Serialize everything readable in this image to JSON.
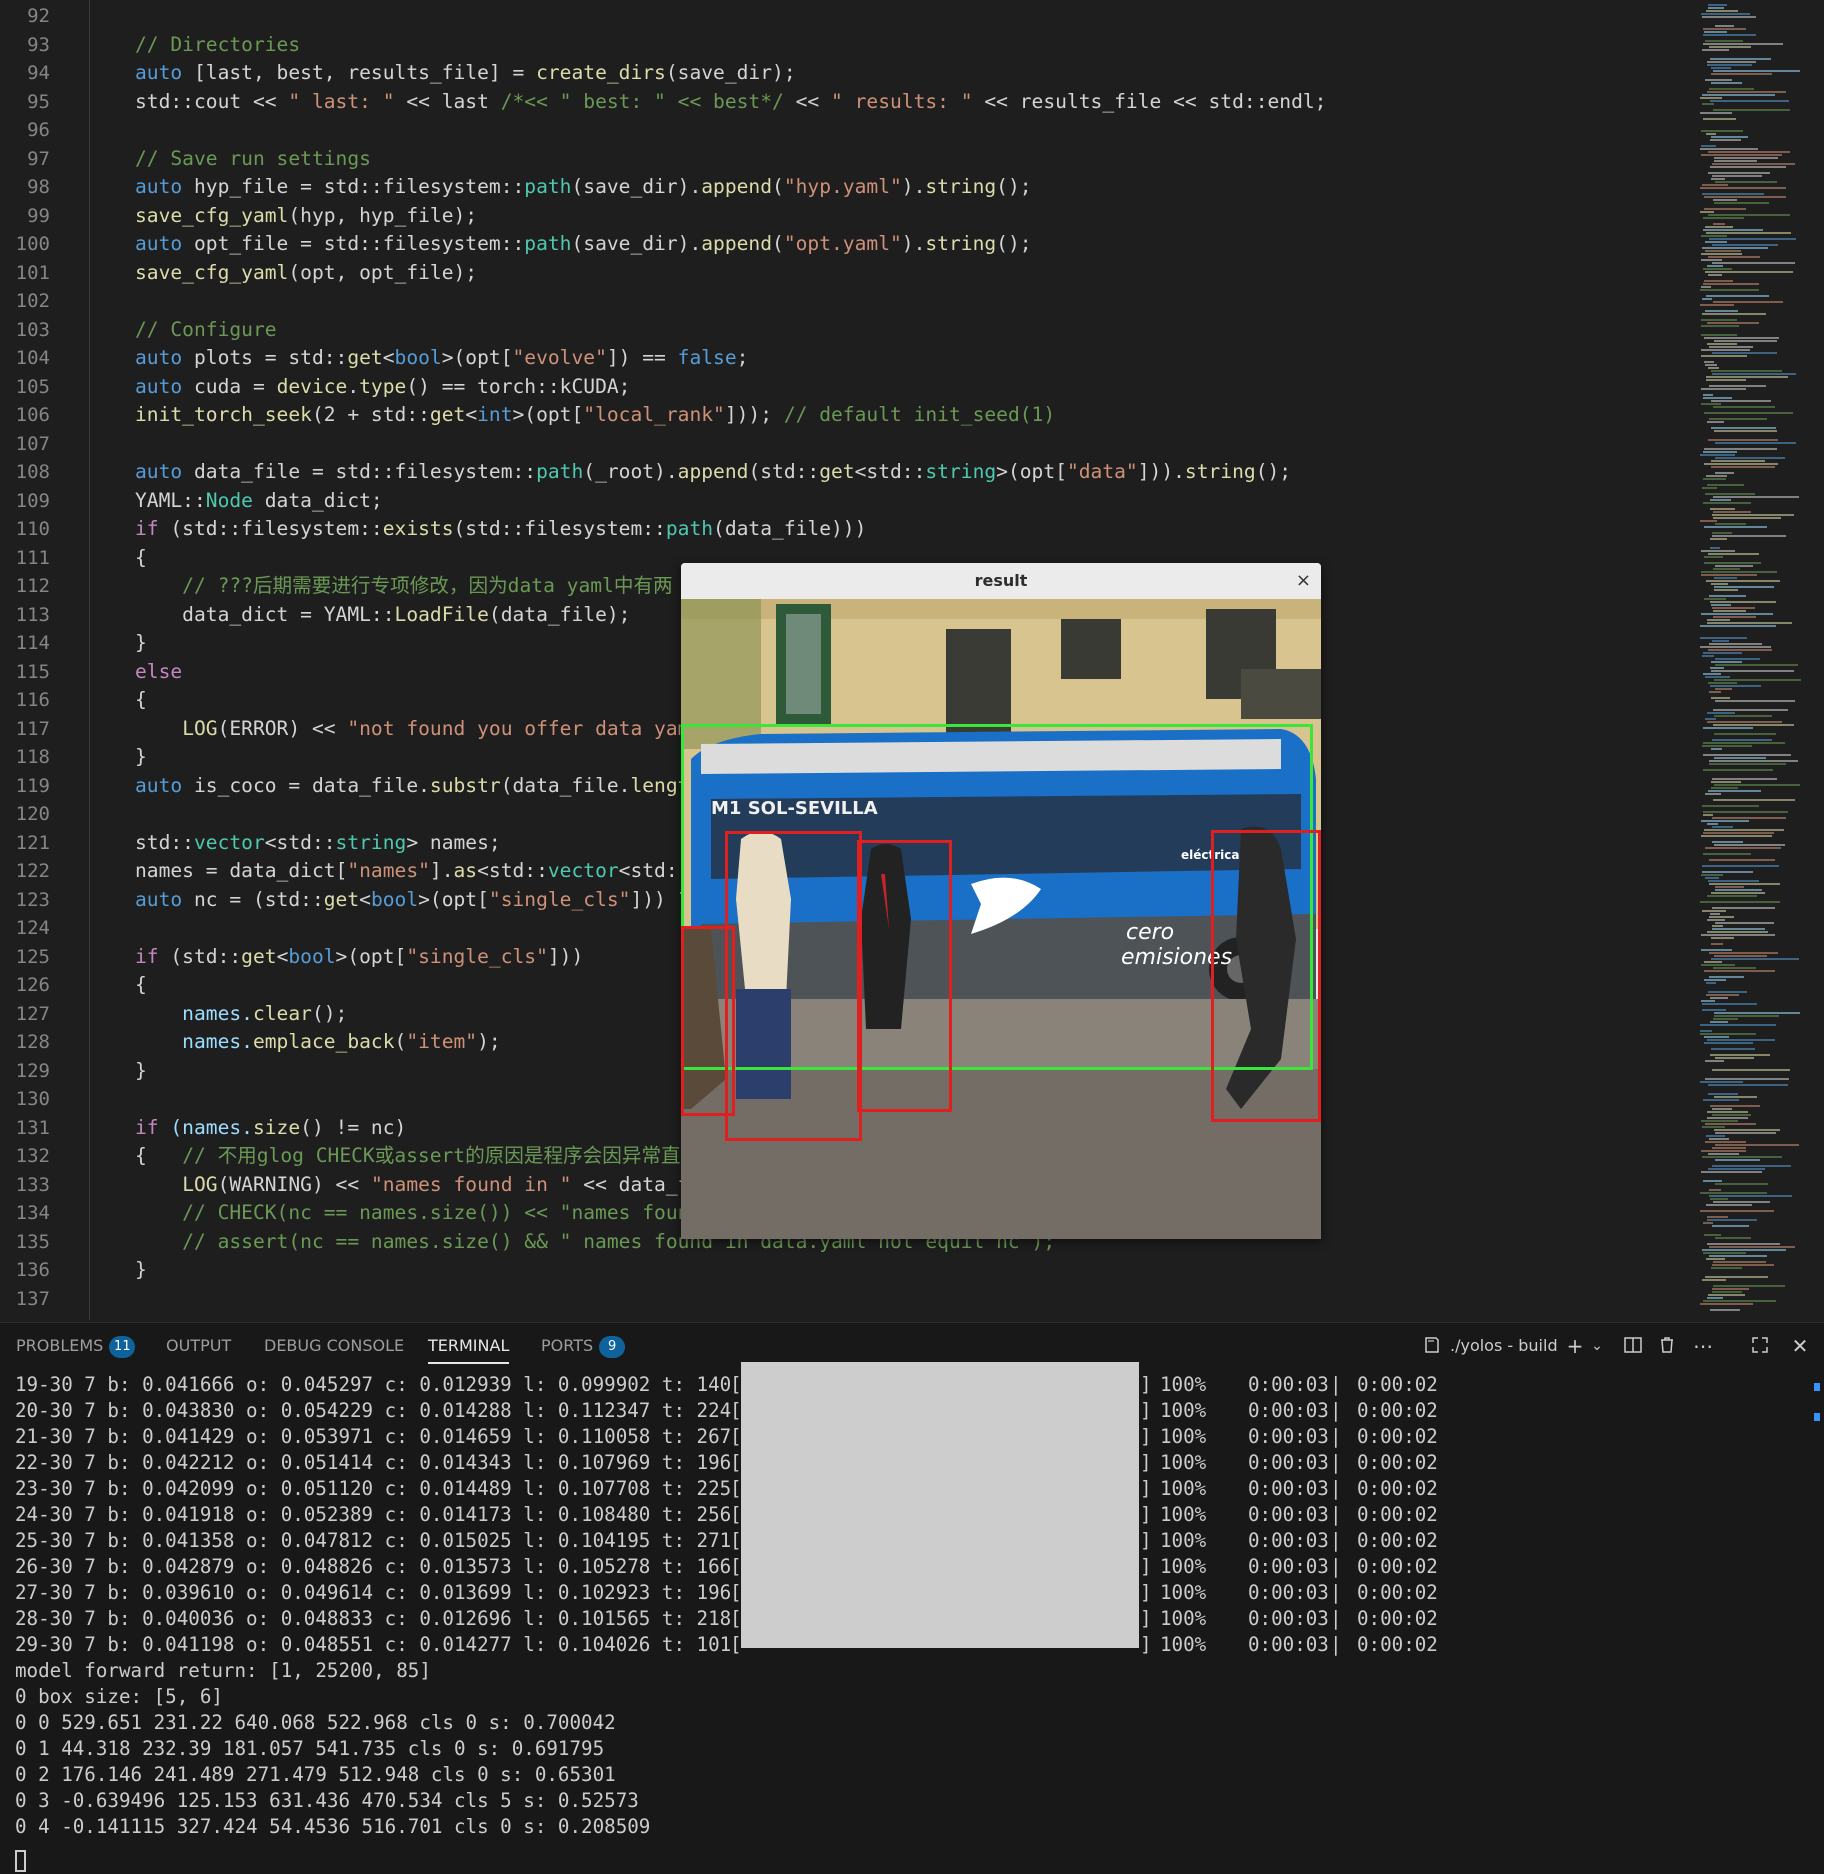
{
  "editor": {
    "lines": [
      {
        "n": "92",
        "segs": []
      },
      {
        "n": "93",
        "segs": [
          {
            "t": "// Directories",
            "c": "#6a9955"
          }
        ]
      },
      {
        "n": "94",
        "segs": [
          {
            "t": "auto ",
            "c": "#569cd6"
          },
          {
            "t": "[last, best, results_file] = ",
            "c": "#d4d4d4"
          },
          {
            "t": "create_dirs",
            "c": "#dcdcaa"
          },
          {
            "t": "(save_dir);",
            "c": "#d4d4d4"
          }
        ]
      },
      {
        "n": "95",
        "segs": [
          {
            "t": "std::cout << ",
            "c": "#d4d4d4"
          },
          {
            "t": "\" last: \"",
            "c": "#ce9178"
          },
          {
            "t": " << last ",
            "c": "#d4d4d4"
          },
          {
            "t": "/*<< \" best: \" << best*/",
            "c": "#6a9955"
          },
          {
            "t": " << ",
            "c": "#d4d4d4"
          },
          {
            "t": "\" results: \"",
            "c": "#ce9178"
          },
          {
            "t": " << results_file << std::endl;",
            "c": "#d4d4d4"
          }
        ]
      },
      {
        "n": "96",
        "segs": []
      },
      {
        "n": "97",
        "segs": [
          {
            "t": "// Save run settings",
            "c": "#6a9955"
          }
        ]
      },
      {
        "n": "98",
        "segs": [
          {
            "t": "auto ",
            "c": "#569cd6"
          },
          {
            "t": "hyp_file = std::filesystem::",
            "c": "#d4d4d4"
          },
          {
            "t": "path",
            "c": "#4ec9b0"
          },
          {
            "t": "(save_dir).",
            "c": "#d4d4d4"
          },
          {
            "t": "append",
            "c": "#dcdcaa"
          },
          {
            "t": "(",
            "c": "#d4d4d4"
          },
          {
            "t": "\"hyp.yaml\"",
            "c": "#ce9178"
          },
          {
            "t": ").",
            "c": "#d4d4d4"
          },
          {
            "t": "string",
            "c": "#dcdcaa"
          },
          {
            "t": "();",
            "c": "#d4d4d4"
          }
        ]
      },
      {
        "n": "99",
        "segs": [
          {
            "t": "save_cfg_yaml",
            "c": "#dcdcaa"
          },
          {
            "t": "(hyp, hyp_file);",
            "c": "#d4d4d4"
          }
        ]
      },
      {
        "n": "100",
        "segs": [
          {
            "t": "auto ",
            "c": "#569cd6"
          },
          {
            "t": "opt_file = std::filesystem::",
            "c": "#d4d4d4"
          },
          {
            "t": "path",
            "c": "#4ec9b0"
          },
          {
            "t": "(save_dir).",
            "c": "#d4d4d4"
          },
          {
            "t": "append",
            "c": "#dcdcaa"
          },
          {
            "t": "(",
            "c": "#d4d4d4"
          },
          {
            "t": "\"opt.yaml\"",
            "c": "#ce9178"
          },
          {
            "t": ").",
            "c": "#d4d4d4"
          },
          {
            "t": "string",
            "c": "#dcdcaa"
          },
          {
            "t": "();",
            "c": "#d4d4d4"
          }
        ]
      },
      {
        "n": "101",
        "segs": [
          {
            "t": "save_cfg_yaml",
            "c": "#dcdcaa"
          },
          {
            "t": "(opt, opt_file);",
            "c": "#d4d4d4"
          }
        ]
      },
      {
        "n": "102",
        "segs": []
      },
      {
        "n": "103",
        "segs": [
          {
            "t": "// Configure",
            "c": "#6a9955"
          }
        ]
      },
      {
        "n": "104",
        "segs": [
          {
            "t": "auto ",
            "c": "#569cd6"
          },
          {
            "t": "plots = std::",
            "c": "#d4d4d4"
          },
          {
            "t": "get",
            "c": "#dcdcaa"
          },
          {
            "t": "<",
            "c": "#d4d4d4"
          },
          {
            "t": "bool",
            "c": "#569cd6"
          },
          {
            "t": ">(opt[",
            "c": "#d4d4d4"
          },
          {
            "t": "\"evolve\"",
            "c": "#ce9178"
          },
          {
            "t": "]) == ",
            "c": "#d4d4d4"
          },
          {
            "t": "false",
            "c": "#569cd6"
          },
          {
            "t": ";",
            "c": "#d4d4d4"
          }
        ]
      },
      {
        "n": "105",
        "segs": [
          {
            "t": "auto ",
            "c": "#569cd6"
          },
          {
            "t": "cuda = ",
            "c": "#d4d4d4"
          },
          {
            "t": "device",
            "c": "#dcdcaa"
          },
          {
            "t": ".",
            "c": "#d4d4d4"
          },
          {
            "t": "type",
            "c": "#dcdcaa"
          },
          {
            "t": "() == torch::kCUDA;",
            "c": "#d4d4d4"
          }
        ]
      },
      {
        "n": "106",
        "segs": [
          {
            "t": "init_torch_seek",
            "c": "#dcdcaa"
          },
          {
            "t": "(2 + std::",
            "c": "#d4d4d4"
          },
          {
            "t": "get",
            "c": "#dcdcaa"
          },
          {
            "t": "<",
            "c": "#d4d4d4"
          },
          {
            "t": "int",
            "c": "#569cd6"
          },
          {
            "t": ">(opt[",
            "c": "#d4d4d4"
          },
          {
            "t": "\"local_rank\"",
            "c": "#ce9178"
          },
          {
            "t": "])); ",
            "c": "#d4d4d4"
          },
          {
            "t": "// default init_seed(1)",
            "c": "#6a9955"
          }
        ]
      },
      {
        "n": "107",
        "segs": []
      },
      {
        "n": "108",
        "segs": [
          {
            "t": "auto ",
            "c": "#569cd6"
          },
          {
            "t": "data_file = std::filesystem::",
            "c": "#d4d4d4"
          },
          {
            "t": "path",
            "c": "#4ec9b0"
          },
          {
            "t": "(_root).",
            "c": "#d4d4d4"
          },
          {
            "t": "append",
            "c": "#dcdcaa"
          },
          {
            "t": "(std::",
            "c": "#d4d4d4"
          },
          {
            "t": "get",
            "c": "#dcdcaa"
          },
          {
            "t": "<std::",
            "c": "#d4d4d4"
          },
          {
            "t": "string",
            "c": "#4ec9b0"
          },
          {
            "t": ">(opt[",
            "c": "#d4d4d4"
          },
          {
            "t": "\"data\"",
            "c": "#ce9178"
          },
          {
            "t": "])).",
            "c": "#d4d4d4"
          },
          {
            "t": "string",
            "c": "#dcdcaa"
          },
          {
            "t": "();",
            "c": "#d4d4d4"
          }
        ]
      },
      {
        "n": "109",
        "segs": [
          {
            "t": "YAML::",
            "c": "#d4d4d4"
          },
          {
            "t": "Node",
            "c": "#4ec9b0"
          },
          {
            "t": " data_dict;",
            "c": "#d4d4d4"
          }
        ]
      },
      {
        "n": "110",
        "segs": [
          {
            "t": "if ",
            "c": "#c586c0"
          },
          {
            "t": "(std::filesystem::",
            "c": "#d4d4d4"
          },
          {
            "t": "exists",
            "c": "#dcdcaa"
          },
          {
            "t": "(std::filesystem::",
            "c": "#d4d4d4"
          },
          {
            "t": "path",
            "c": "#4ec9b0"
          },
          {
            "t": "(data_file)))",
            "c": "#d4d4d4"
          }
        ]
      },
      {
        "n": "111",
        "segs": [
          {
            "t": "{",
            "c": "#d4d4d4"
          }
        ]
      },
      {
        "n": "112",
        "segs": [
          {
            "t": "    // ???后期需要进行专项修改，因为data yaml中有两",
            "c": "#6a9955"
          }
        ]
      },
      {
        "n": "113",
        "segs": [
          {
            "t": "    data_dict = YAML::",
            "c": "#d4d4d4"
          },
          {
            "t": "LoadFile",
            "c": "#dcdcaa"
          },
          {
            "t": "(data_file);",
            "c": "#d4d4d4"
          }
        ]
      },
      {
        "n": "114",
        "segs": [
          {
            "t": "}",
            "c": "#d4d4d4"
          }
        ]
      },
      {
        "n": "115",
        "segs": [
          {
            "t": "else",
            "c": "#c586c0"
          }
        ]
      },
      {
        "n": "116",
        "segs": [
          {
            "t": "{",
            "c": "#d4d4d4"
          }
        ]
      },
      {
        "n": "117",
        "segs": [
          {
            "t": "    ",
            "c": "#d4d4d4"
          },
          {
            "t": "LOG",
            "c": "#dcdcaa"
          },
          {
            "t": "(ERROR) << ",
            "c": "#d4d4d4"
          },
          {
            "t": "\"not found you offer data yaml",
            "c": "#ce9178"
          }
        ]
      },
      {
        "n": "118",
        "segs": [
          {
            "t": "}",
            "c": "#d4d4d4"
          }
        ]
      },
      {
        "n": "119",
        "segs": [
          {
            "t": "auto ",
            "c": "#569cd6"
          },
          {
            "t": "is_coco = data_file.",
            "c": "#d4d4d4"
          },
          {
            "t": "substr",
            "c": "#dcdcaa"
          },
          {
            "t": "(data_file.",
            "c": "#d4d4d4"
          },
          {
            "t": "length",
            "c": "#dcdcaa"
          }
        ]
      },
      {
        "n": "120",
        "segs": []
      },
      {
        "n": "121",
        "segs": [
          {
            "t": "std::",
            "c": "#d4d4d4"
          },
          {
            "t": "vector",
            "c": "#4ec9b0"
          },
          {
            "t": "<std::",
            "c": "#d4d4d4"
          },
          {
            "t": "string",
            "c": "#4ec9b0"
          },
          {
            "t": "> names;",
            "c": "#d4d4d4"
          }
        ]
      },
      {
        "n": "122",
        "segs": [
          {
            "t": "names = data_dict[",
            "c": "#d4d4d4"
          },
          {
            "t": "\"names\"",
            "c": "#ce9178"
          },
          {
            "t": "].",
            "c": "#d4d4d4"
          },
          {
            "t": "as",
            "c": "#dcdcaa"
          },
          {
            "t": "<std::",
            "c": "#d4d4d4"
          },
          {
            "t": "vector",
            "c": "#4ec9b0"
          },
          {
            "t": "<std::s",
            "c": "#d4d4d4"
          }
        ]
      },
      {
        "n": "123",
        "segs": [
          {
            "t": "auto ",
            "c": "#569cd6"
          },
          {
            "t": "nc = (std::",
            "c": "#d4d4d4"
          },
          {
            "t": "get",
            "c": "#dcdcaa"
          },
          {
            "t": "<",
            "c": "#d4d4d4"
          },
          {
            "t": "bool",
            "c": "#569cd6"
          },
          {
            "t": ">(opt[",
            "c": "#d4d4d4"
          },
          {
            "t": "\"single_cls\"",
            "c": "#ce9178"
          },
          {
            "t": "])) ?",
            "c": "#d4d4d4"
          }
        ]
      },
      {
        "n": "124",
        "segs": []
      },
      {
        "n": "125",
        "segs": [
          {
            "t": "if ",
            "c": "#c586c0"
          },
          {
            "t": "(std::",
            "c": "#d4d4d4"
          },
          {
            "t": "get",
            "c": "#dcdcaa"
          },
          {
            "t": "<",
            "c": "#d4d4d4"
          },
          {
            "t": "bool",
            "c": "#569cd6"
          },
          {
            "t": ">(opt[",
            "c": "#d4d4d4"
          },
          {
            "t": "\"single_cls\"",
            "c": "#ce9178"
          },
          {
            "t": "]))",
            "c": "#d4d4d4"
          }
        ]
      },
      {
        "n": "126",
        "segs": [
          {
            "t": "{",
            "c": "#d4d4d4"
          }
        ]
      },
      {
        "n": "127",
        "segs": [
          {
            "t": "    names.",
            "c": "#9cdcfe"
          },
          {
            "t": "clear",
            "c": "#dcdcaa"
          },
          {
            "t": "();",
            "c": "#d4d4d4"
          }
        ]
      },
      {
        "n": "128",
        "segs": [
          {
            "t": "    names.",
            "c": "#9cdcfe"
          },
          {
            "t": "emplace_back",
            "c": "#dcdcaa"
          },
          {
            "t": "(",
            "c": "#d4d4d4"
          },
          {
            "t": "\"item\"",
            "c": "#ce9178"
          },
          {
            "t": ");",
            "c": "#d4d4d4"
          }
        ]
      },
      {
        "n": "129",
        "segs": [
          {
            "t": "}",
            "c": "#d4d4d4"
          }
        ]
      },
      {
        "n": "130",
        "segs": []
      },
      {
        "n": "131",
        "segs": [
          {
            "t": "if ",
            "c": "#c586c0"
          },
          {
            "t": "(names.",
            "c": "#9cdcfe"
          },
          {
            "t": "size",
            "c": "#dcdcaa"
          },
          {
            "t": "() != nc)",
            "c": "#d4d4d4"
          }
        ]
      },
      {
        "n": "132",
        "segs": [
          {
            "t": "{   ",
            "c": "#d4d4d4"
          },
          {
            "t": "// 不用glog CHECK或assert的原因是程序会因异常直",
            "c": "#6a9955"
          }
        ]
      },
      {
        "n": "133",
        "segs": [
          {
            "t": "    ",
            "c": "#d4d4d4"
          },
          {
            "t": "LOG",
            "c": "#dcdcaa"
          },
          {
            "t": "(WARNING) << ",
            "c": "#d4d4d4"
          },
          {
            "t": "\"names found in \"",
            "c": "#ce9178"
          },
          {
            "t": " << data_fi                                               dl;",
            "c": "#d4d4d4"
          }
        ]
      },
      {
        "n": "134",
        "segs": [
          {
            "t": "    // CHECK(nc == names.size()) << \"names found                                              << nc;",
            "c": "#6a9955"
          }
        ]
      },
      {
        "n": "135",
        "segs": [
          {
            "t": "    // assert(nc == names.size() && \" names found in data.yaml not equil nc\");",
            "c": "#6a9955"
          }
        ]
      },
      {
        "n": "136",
        "segs": [
          {
            "t": "}",
            "c": "#d4d4d4"
          }
        ]
      },
      {
        "n": "137",
        "segs": []
      }
    ]
  },
  "panel": {
    "tabs": [
      {
        "label": "PROBLEMS",
        "badge": "11"
      },
      {
        "label": "OUTPUT",
        "badge": ""
      },
      {
        "label": "DEBUG CONSOLE",
        "badge": ""
      },
      {
        "label": "TERMINAL",
        "badge": ""
      },
      {
        "label": "PORTS",
        "badge": "9"
      }
    ],
    "terminal_name": "./yolos - build",
    "icons": [
      "terminal-icon",
      "add-icon",
      "chevron-down-icon",
      "split-icon",
      "trash-icon",
      "more-icon",
      "maximize-icon",
      "close-icon"
    ]
  },
  "terminal": {
    "progress_rows": [
      {
        "left": "19-30 7 b: 0.041666 o: 0.045297 c: 0.012939 l: 0.099902 t: 140",
        "pct": "100%",
        "elapsed": "0:00:03",
        "remaining": "0:00:02"
      },
      {
        "left": "20-30 7 b: 0.043830 o: 0.054229 c: 0.014288 l: 0.112347 t: 224",
        "pct": "100%",
        "elapsed": "0:00:03",
        "remaining": "0:00:02"
      },
      {
        "left": "21-30 7 b: 0.041429 o: 0.053971 c: 0.014659 l: 0.110058 t: 267",
        "pct": "100%",
        "elapsed": "0:00:03",
        "remaining": "0:00:02"
      },
      {
        "left": "22-30 7 b: 0.042212 o: 0.051414 c: 0.014343 l: 0.107969 t: 196",
        "pct": "100%",
        "elapsed": "0:00:03",
        "remaining": "0:00:02"
      },
      {
        "left": "23-30 7 b: 0.042099 o: 0.051120 c: 0.014489 l: 0.107708 t: 225",
        "pct": "100%",
        "elapsed": "0:00:03",
        "remaining": "0:00:02"
      },
      {
        "left": "24-30 7 b: 0.041918 o: 0.052389 c: 0.014173 l: 0.108480 t: 256",
        "pct": "100%",
        "elapsed": "0:00:03",
        "remaining": "0:00:02"
      },
      {
        "left": "25-30 7 b: 0.041358 o: 0.047812 c: 0.015025 l: 0.104195 t: 271",
        "pct": "100%",
        "elapsed": "0:00:03",
        "remaining": "0:00:02"
      },
      {
        "left": "26-30 7 b: 0.042879 o: 0.048826 c: 0.013573 l: 0.105278 t: 166",
        "pct": "100%",
        "elapsed": "0:00:03",
        "remaining": "0:00:02"
      },
      {
        "left": "27-30 7 b: 0.039610 o: 0.049614 c: 0.013699 l: 0.102923 t: 196",
        "pct": "100%",
        "elapsed": "0:00:03",
        "remaining": "0:00:02"
      },
      {
        "left": "28-30 7 b: 0.040036 o: 0.048833 c: 0.012696 l: 0.101565 t: 218",
        "pct": "100%",
        "elapsed": "0:00:03",
        "remaining": "0:00:02"
      },
      {
        "left": "29-30 7 b: 0.041198 o: 0.048551 c: 0.014277 l: 0.104026 t: 101",
        "pct": "100%",
        "elapsed": "0:00:03",
        "remaining": "0:00:02"
      }
    ],
    "output_lines": [
      "model forward return: [1, 25200, 85]",
      "0 box size: [5, 6]",
      "0 0 529.651 231.22 640.068 522.968 cls 0 s: 0.700042",
      "0 1 44.318 232.39 181.057 541.735 cls 0 s: 0.691795",
      "0 2 176.146 241.489 271.479 512.948 cls 0 s: 0.65301",
      "0 3 -0.639496 125.153 631.436 470.534 cls 5 s: 0.52573",
      "0 4 -0.141115 327.424 54.4536 516.701 cls 0 s: 0.208509"
    ]
  },
  "result_window": {
    "title": "result",
    "close": "×",
    "bus_sign": "M1 SOL-SEVILLA",
    "bus_text_1": "cero",
    "bus_text_2": "emisiones",
    "bus_brand": "eléctricaEMTe",
    "box_colors": {
      "person": "#e02020",
      "bus": "#39e639"
    }
  }
}
